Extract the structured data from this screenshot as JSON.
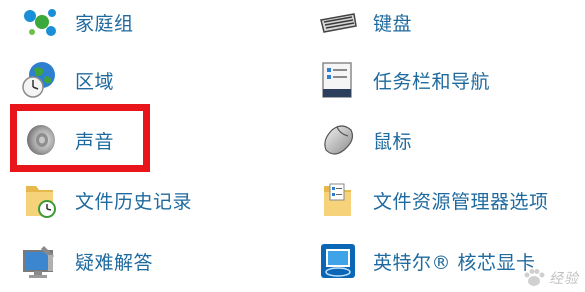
{
  "items": [
    {
      "label": "家庭组",
      "icon": "homegroup-icon"
    },
    {
      "label": "键盘",
      "icon": "keyboard-icon"
    },
    {
      "label": "区域",
      "icon": "region-globe-clock-icon"
    },
    {
      "label": "任务栏和导航",
      "icon": "taskbar-navigation-icon"
    },
    {
      "label": "声音",
      "icon": "speaker-icon"
    },
    {
      "label": "鼠标",
      "icon": "mouse-icon"
    },
    {
      "label": "文件历史记录",
      "icon": "file-history-icon"
    },
    {
      "label": "文件资源管理器选项",
      "icon": "file-explorer-options-icon"
    },
    {
      "label": "疑难解答",
      "icon": "troubleshooting-icon"
    },
    {
      "label": "英特尔® 核芯显卡",
      "icon": "intel-graphics-icon"
    }
  ],
  "highlight": {
    "target": "声音",
    "color": "#e8161b"
  },
  "watermark": {
    "text": "经验"
  },
  "colors": {
    "label": "#1f6a9e",
    "background": "#ffffff"
  }
}
